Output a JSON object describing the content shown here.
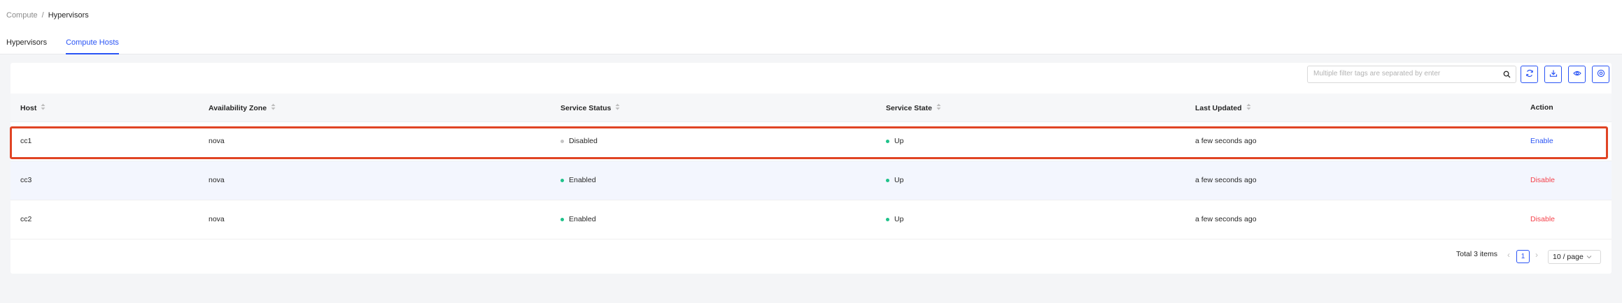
{
  "breadcrumb": {
    "parent": "Compute",
    "separator": "/",
    "current": "Hypervisors"
  },
  "tabs": [
    {
      "label": "Hypervisors",
      "active": false
    },
    {
      "label": "Compute Hosts",
      "active": true
    }
  ],
  "toolbar": {
    "search_placeholder": "Multiple filter tags are separated by enter",
    "buttons": [
      "refresh-icon",
      "download-icon",
      "eye-icon",
      "settings-icon"
    ]
  },
  "table": {
    "columns": [
      "Host",
      "Availability Zone",
      "Service Status",
      "Service State",
      "Last Updated",
      "Action"
    ],
    "rows": [
      {
        "host": "cc1",
        "zone": "nova",
        "status": "Disabled",
        "state": "Up",
        "updated": "a few seconds ago",
        "action": "Enable"
      },
      {
        "host": "cc3",
        "zone": "nova",
        "status": "Enabled",
        "state": "Up",
        "updated": "a few seconds ago",
        "action": "Disable"
      },
      {
        "host": "cc2",
        "zone": "nova",
        "status": "Enabled",
        "state": "Up",
        "updated": "a few seconds ago",
        "action": "Disable"
      }
    ]
  },
  "pagination": {
    "total": "Total 3 items",
    "page": "1",
    "page_size": "10 / page"
  },
  "colors": {
    "accent": "#2a54f5",
    "danger": "#f5424b",
    "success": "#1ec28a",
    "muted": "#c4c4c4",
    "highlight": "#e04424"
  }
}
